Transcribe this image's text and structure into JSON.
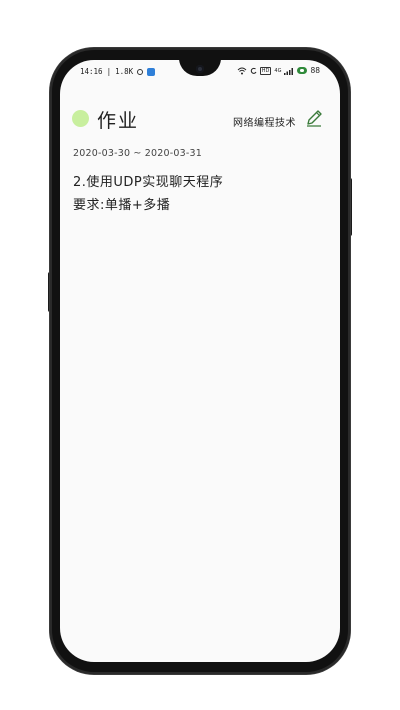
{
  "status_bar": {
    "time": "14:16",
    "separator": "|",
    "net_speed": "1.8K",
    "hd_label": "HD",
    "signal": "4G",
    "battery": "88"
  },
  "header": {
    "title": "作业",
    "course_name": "网络编程技术"
  },
  "assignment": {
    "date_range": "2020-03-30 ~ 2020-03-31",
    "title": "2.使用UDP实现聊天程序",
    "requirement": "要求:单播+多播"
  },
  "colors": {
    "accent_dot": "#c8ef9e",
    "edit_icon_stroke": "#3a7a3a",
    "battery": "#2f8a3a"
  },
  "icons": {
    "header_dot": "circle-dot-icon",
    "edit": "pencil-icon"
  }
}
